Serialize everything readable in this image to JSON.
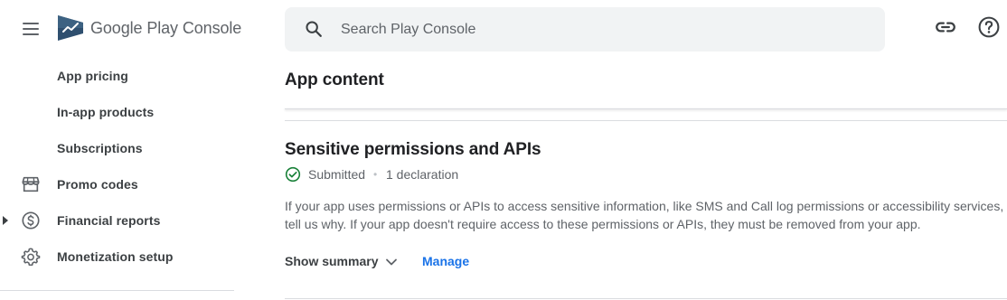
{
  "app": {
    "logo_brand": "Google Play",
    "logo_product": "Console"
  },
  "colors": {
    "accent": "#1a73e8",
    "success": "#188038",
    "search_bg": "#f1f3f4",
    "text_primary": "#202124",
    "text_secondary": "#5f6368"
  },
  "header": {
    "search": {
      "placeholder": "Search Play Console",
      "value": "",
      "icon": "search-icon"
    },
    "actions": [
      {
        "icon": "link-icon"
      },
      {
        "icon": "help-icon"
      }
    ]
  },
  "sidebar": {
    "items": [
      {
        "label": "App pricing",
        "icon": null
      },
      {
        "label": "In-app products",
        "icon": null
      },
      {
        "label": "Subscriptions",
        "icon": null
      },
      {
        "label": "Promo codes",
        "icon": "store-icon"
      },
      {
        "label": "Financial reports",
        "icon": "dollar-circle-icon",
        "expandable": true
      },
      {
        "label": "Monetization setup",
        "icon": "gear-icon"
      }
    ]
  },
  "main": {
    "page_title": "App content",
    "section": {
      "title": "Sensitive permissions and APIs",
      "status": "Submitted",
      "separator": "•",
      "declaration_count": "1 declaration",
      "description_line_1": "If your app uses permissions or APIs to access sensitive information, like SMS and Call log permissions or accessibility services,",
      "description_line_2": "tell us why. If your app doesn't require access to these permissions or APIs, they must be removed from your app.",
      "show_summary_label": "Show summary",
      "manage_label": "Manage"
    }
  }
}
